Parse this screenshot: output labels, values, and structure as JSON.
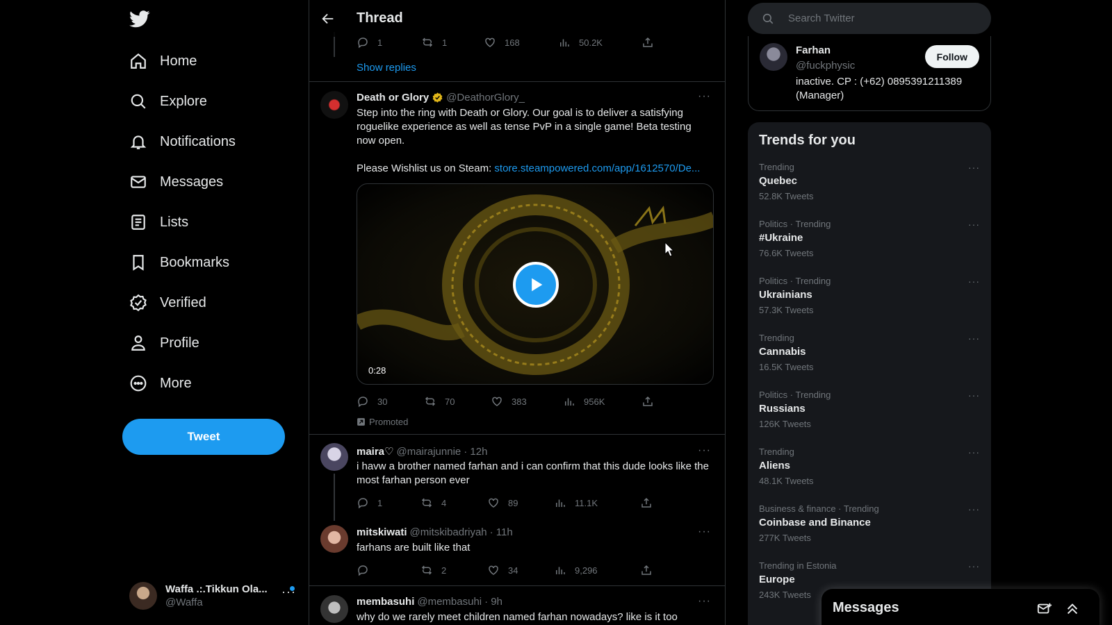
{
  "colors": {
    "accent": "#1d9bf0",
    "background": "#000000",
    "border": "#2f3336",
    "muted": "#71767b",
    "panel": "#16181c"
  },
  "nav": {
    "logo": "twitter-bird-icon",
    "items": [
      {
        "label": "Home",
        "icon": "home-icon"
      },
      {
        "label": "Explore",
        "icon": "search-icon"
      },
      {
        "label": "Notifications",
        "icon": "bell-icon"
      },
      {
        "label": "Messages",
        "icon": "envelope-icon"
      },
      {
        "label": "Lists",
        "icon": "list-icon"
      },
      {
        "label": "Bookmarks",
        "icon": "bookmark-icon"
      },
      {
        "label": "Verified",
        "icon": "verified-badge-icon"
      },
      {
        "label": "Profile",
        "icon": "person-icon"
      },
      {
        "label": "More",
        "icon": "more-circle-icon"
      }
    ],
    "tweet_button": "Tweet",
    "account": {
      "display_name": "Waffa .:.Tikkun Ola...",
      "handle": "@Waffa"
    }
  },
  "header": {
    "title": "Thread"
  },
  "top_tweet_actions": {
    "replies": "1",
    "retweets": "1",
    "likes": "168",
    "views": "50.2K"
  },
  "show_replies": "Show replies",
  "promoted_tweet": {
    "name": "Death or Glory",
    "handle": "@DeathorGlory_",
    "text_line1": "Step into the ring with Death or Glory. Our goal is to deliver a satisfying roguelike experience as well as tense PvP in a single game! Beta testing now open.",
    "text_line2_prefix": "Please Wishlist us on Steam: ",
    "link": "store.steampowered.com/app/1612570/De...",
    "video_duration": "0:28",
    "replies": "30",
    "retweets": "70",
    "likes": "383",
    "views": "956K",
    "promoted_label": "Promoted"
  },
  "replies": [
    {
      "name": "maira♡",
      "handle": "@mairajunnie",
      "time": "· 12h",
      "text": "i havw a brother named farhan and i can confirm that this dude looks like the most farhan person ever",
      "replies": "1",
      "retweets": "4",
      "likes": "89",
      "views": "11.1K"
    },
    {
      "name": "mitskiwati",
      "handle": "@mitskibadriyah",
      "time": "· 11h",
      "text": "farhans are built like that",
      "replies": "",
      "retweets": "2",
      "likes": "34",
      "views": "9,296"
    },
    {
      "name": "membasuhi",
      "handle": "@membasuhi",
      "time": "· 9h",
      "text": "why do we rarely meet children named farhan nowadays? like is it too"
    }
  ],
  "search": {
    "placeholder": "Search Twitter"
  },
  "who": {
    "name": "Farhan",
    "handle": "@fuckphysic",
    "bio": "inactive. CP : (+62) 0895391211389 (Manager)",
    "follow": "Follow"
  },
  "trends": {
    "title": "Trends for you",
    "items": [
      {
        "meta": "Trending",
        "name": "Quebec",
        "count": "52.8K Tweets"
      },
      {
        "meta": "Politics · Trending",
        "name": "#Ukraine",
        "count": "76.6K Tweets"
      },
      {
        "meta": "Politics · Trending",
        "name": "Ukrainians",
        "count": "57.3K Tweets"
      },
      {
        "meta": "Trending",
        "name": "Cannabis",
        "count": "16.5K Tweets"
      },
      {
        "meta": "Politics · Trending",
        "name": "Russians",
        "count": "126K Tweets"
      },
      {
        "meta": "Trending",
        "name": "Aliens",
        "count": "48.1K Tweets"
      },
      {
        "meta": "Business & finance · Trending",
        "name": "Coinbase and Binance",
        "count": "277K Tweets"
      },
      {
        "meta": "Trending in Estonia",
        "name": "Europe",
        "count": "243K Tweets"
      }
    ]
  },
  "messages_dock": {
    "title": "Messages"
  }
}
